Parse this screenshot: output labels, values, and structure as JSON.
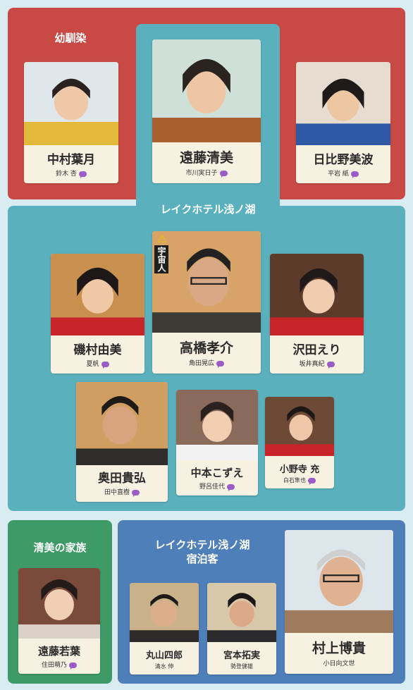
{
  "groups": {
    "childhood": "幼馴染",
    "hotel": "レイクホテル浅ノ湖",
    "family": "清美の家族",
    "guests_line1": "レイクホテル浅ノ湖",
    "guests_line2": "宿泊客"
  },
  "badge": "宇宙人",
  "cast": [
    {
      "role": "中村葉月",
      "actor": "鈴木 杏"
    },
    {
      "role": "遠藤清美",
      "actor": "市川実日子"
    },
    {
      "role": "日比野美波",
      "actor": "平岩 紙"
    },
    {
      "role": "磯村由美",
      "actor": "夏帆"
    },
    {
      "role": "高橋孝介",
      "actor": "角田晃広"
    },
    {
      "role": "沢田えり",
      "actor": "坂井真紀"
    },
    {
      "role": "奥田貴弘",
      "actor": "田中直樹"
    },
    {
      "role": "中本こずえ",
      "actor": "野呂佳代"
    },
    {
      "role": "小野寺 充",
      "actor": "白石隼也"
    },
    {
      "role": "遠藤若葉",
      "actor": "住田萌乃"
    },
    {
      "role": "丸山四郎",
      "actor": "清水 伸"
    },
    {
      "role": "宮本拓実",
      "actor": "勢登健雄"
    },
    {
      "role": "村上博貴",
      "actor": "小日向文世"
    }
  ]
}
